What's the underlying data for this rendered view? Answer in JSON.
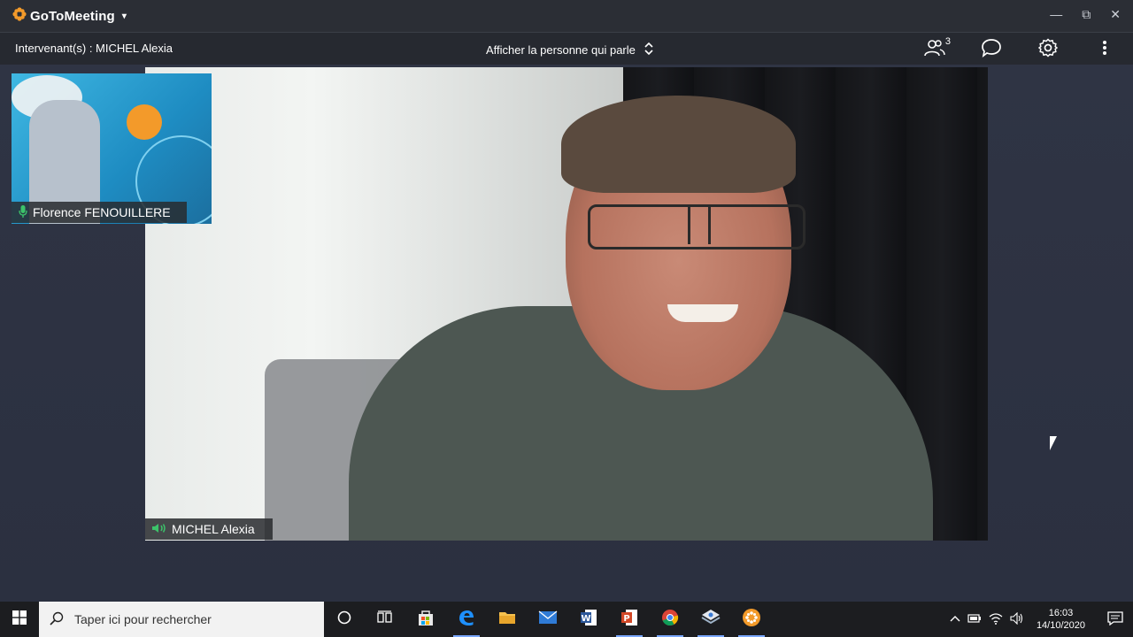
{
  "titlebar": {
    "brand_name": "GoToMeeting",
    "brand_caret": "▾",
    "window_controls": {
      "minimize": "—",
      "restore": "⧉",
      "close": "✕"
    }
  },
  "toolbar": {
    "presenter_label": "Intervenant(s) : MICHEL Alexia",
    "view_select_label": "Afficher la personne qui parle",
    "attendees_count": "3",
    "icons": [
      "attendees-icon",
      "chat-icon",
      "settings-icon",
      "more-icon"
    ]
  },
  "video": {
    "main_speaker": "MICHEL Alexia",
    "thumbnail_name": "Florence FENOUILLERE"
  },
  "taskbar": {
    "search_placeholder": "Taper ici pour rechercher",
    "apps": [
      "task-view-icon",
      "store-icon",
      "edge-icon",
      "file-explorer-icon",
      "mail-icon",
      "word-icon",
      "powerpoint-icon",
      "chrome-icon",
      "app-icon",
      "gotomeeting-icon"
    ],
    "time": "16:03",
    "date": "14/10/2020"
  },
  "colors": {
    "brand_orange": "#f39a2a",
    "mic_green": "#3cc36a",
    "taskbar_active": "#7aa7ff"
  }
}
